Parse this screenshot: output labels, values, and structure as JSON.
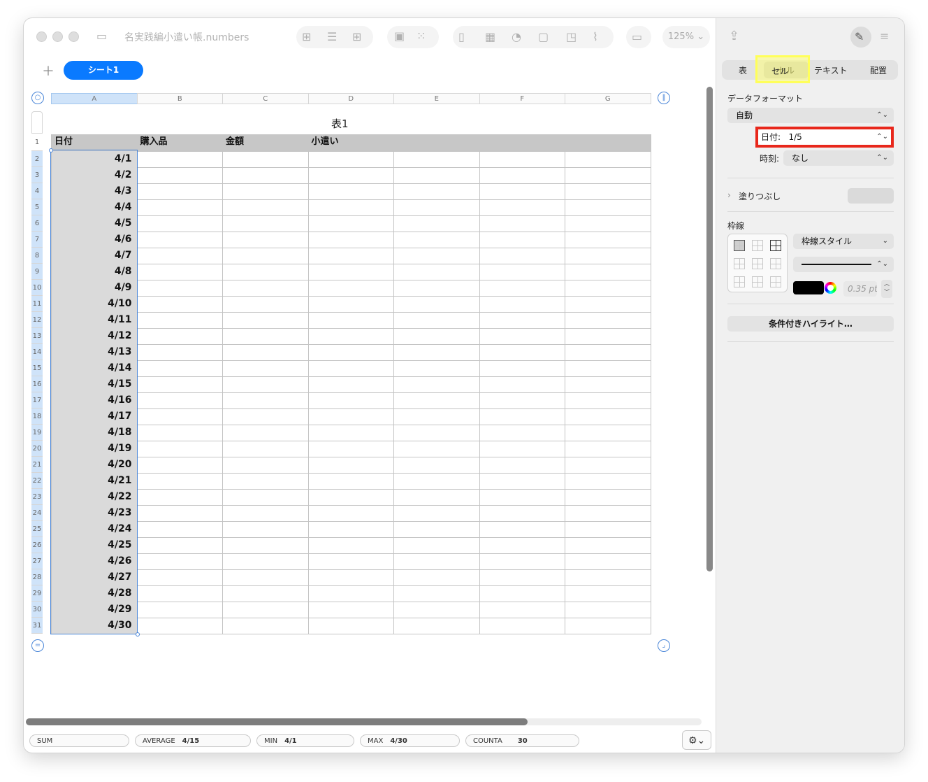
{
  "window": {
    "title": "名実践編小遣い帳.numbers",
    "zoom": "125%"
  },
  "sheets": [
    {
      "label": "シート1"
    }
  ],
  "columns": [
    "A",
    "B",
    "C",
    "D",
    "E",
    "F",
    "G"
  ],
  "table": {
    "title": "表1",
    "headers": [
      "日付",
      "購入品",
      "金額",
      "小遣い",
      "",
      "",
      ""
    ],
    "rows": [
      "4/1",
      "4/2",
      "4/3",
      "4/4",
      "4/5",
      "4/6",
      "4/7",
      "4/8",
      "4/9",
      "4/10",
      "4/11",
      "4/12",
      "4/13",
      "4/14",
      "4/15",
      "4/16",
      "4/17",
      "4/18",
      "4/19",
      "4/20",
      "4/21",
      "4/22",
      "4/23",
      "4/24",
      "4/25",
      "4/26",
      "4/27",
      "4/28",
      "4/29",
      "4/30"
    ]
  },
  "statusbar": [
    {
      "label": "SUM",
      "value": ""
    },
    {
      "label": "AVERAGE",
      "value": "4/15"
    },
    {
      "label": "MIN",
      "value": "4/1"
    },
    {
      "label": "MAX",
      "value": "4/30"
    },
    {
      "label": "COUNTA",
      "value": "30"
    }
  ],
  "inspector": {
    "tabs": [
      "表",
      "セル",
      "テキスト",
      "配置"
    ],
    "selected_tab": "セル",
    "data_format_label": "データフォーマット",
    "data_format_value": "自動",
    "date_label": "日付:",
    "date_value": "1/5",
    "time_label": "時刻:",
    "time_value": "なし",
    "fill_label": "塗りつぶし",
    "border_label": "枠線",
    "border_style_label": "枠線スタイル",
    "border_width": "0.35 pt",
    "border_color": "#000000",
    "conditional_highlight": "条件付きハイライト…"
  },
  "colors": {
    "accent": "#0a7aff",
    "highlight_yellow": "#ffff5a",
    "highlight_red": "#e8271b"
  }
}
